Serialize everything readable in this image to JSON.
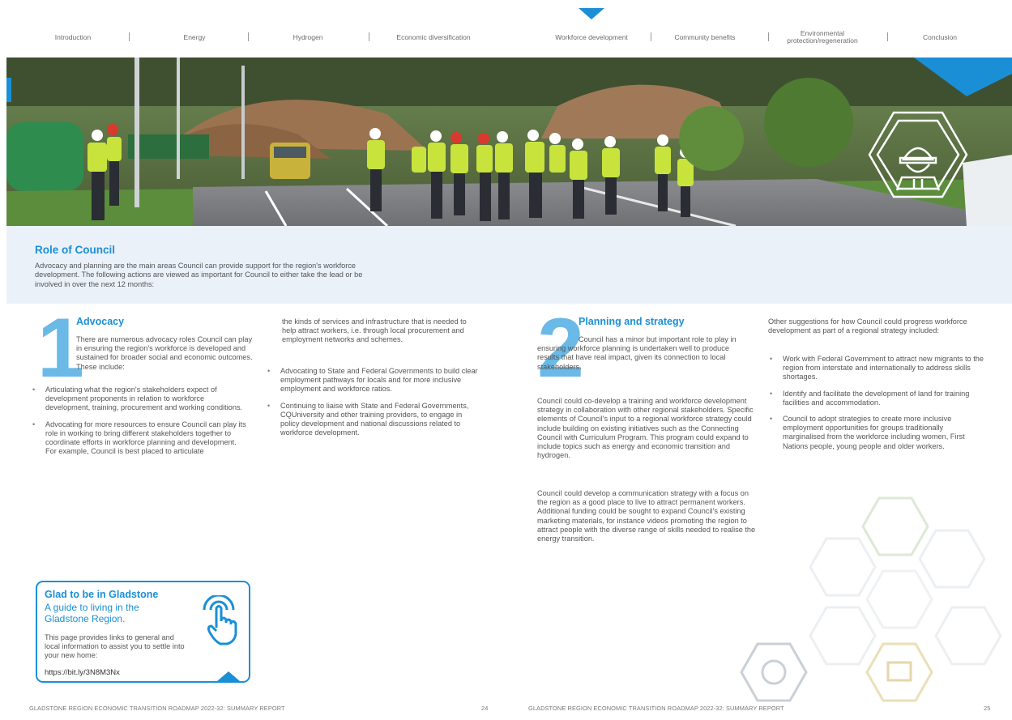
{
  "nav": {
    "items": [
      {
        "label": "Introduction"
      },
      {
        "label": "Energy"
      },
      {
        "label": "Hydrogen"
      },
      {
        "label": "Economic diversification"
      },
      {
        "label": "Workforce development"
      },
      {
        "label": "Community benefits"
      },
      {
        "label": "Environmental protection/regeneration"
      },
      {
        "label": "Conclusion"
      }
    ],
    "active_index": 4,
    "accent_color": "#1b8fd6"
  },
  "role": {
    "title": "Role of Council",
    "body": "Advocacy and planning are the main areas Council can provide support for the region's workforce development. The following actions are viewed as important for Council to either take the lead or be involved in over the next 12 months:"
  },
  "advocacy": {
    "number": "1",
    "heading": "Advocacy",
    "intro": "There are numerous advocacy roles Council can play in ensuring the region's workforce is developed and sustained for broader social and economic outcomes. These include:",
    "bullets_left": [
      "Articulating what the region's stakeholders expect of development proponents in relation to workforce development, training, procurement and working conditions.",
      "Advocating for more resources to ensure Council can play its role in working to bring different stakeholders together to coordinate efforts in workforce planning and development. For example, Council is best placed to articulate"
    ],
    "continuation": "the kinds of services and infrastructure that is needed to help attract workers, i.e. through local procurement and employment networks and schemes.",
    "bullets_right": [
      "Advocating to State and Federal Governments to build clear employment pathways for locals and for more inclusive employment and workforce ratios.",
      "Continuing to liaise with State and Federal Governments, CQUniversity and other training providers, to engage in policy development and national discussions related to workforce development."
    ]
  },
  "planning": {
    "number": "2",
    "heading": "Planning and strategy",
    "intro": "Council has a minor but important role to play in ensuring workforce planning is undertaken well to produce results that have real impact, given its connection to local stakeholders.",
    "para1": "Council could co-develop a training and workforce development strategy in collaboration with other regional stakeholders. Specific elements of Council's input to a regional workforce strategy could include building on existing initiatives such as the Connecting Council with Curriculum Program. This program could expand to include topics such as energy and economic transition and hydrogen.",
    "para2": "Council could develop a communication strategy with a focus on the region as a good place to live to attract permanent workers. Additional funding could be sought to expand Council's existing marketing materials, for instance videos promoting the region to attract people with the diverse range of skills needed to realise the energy transition.",
    "right_intro": "Other suggestions for how Council could progress workforce development as part of a regional strategy included:",
    "right_bullets": [
      "Work with Federal Government to attract new migrants to the region from interstate and internationally to address skills shortages.",
      "Identify and facilitate the development of land for training facilities and accommodation.",
      "Council to adopt strategies to create more inclusive employment opportunities for groups traditionally marginalised from the workforce including women, First Nations people, young people and older workers."
    ]
  },
  "callout": {
    "title": "Glad to be in Gladstone",
    "subtitle": "A guide to living in the Gladstone Region.",
    "body": "This page provides links to general and local information to assist you to settle into your new home:",
    "link": "https://bit.ly/3N8M3Nx",
    "icon": "touch-hand-icon"
  },
  "footer": {
    "left_title": "GLADSTONE REGION ECONOMIC TRANSITION ROADMAP 2022-32: SUMMARY REPORT",
    "left_page": "24",
    "right_title": "GLADSTONE REGION ECONOMIC TRANSITION ROADMAP 2022-32: SUMMARY REPORT",
    "right_page": "25"
  },
  "hero": {
    "description_icon": "hard-hat-worker-icon"
  }
}
